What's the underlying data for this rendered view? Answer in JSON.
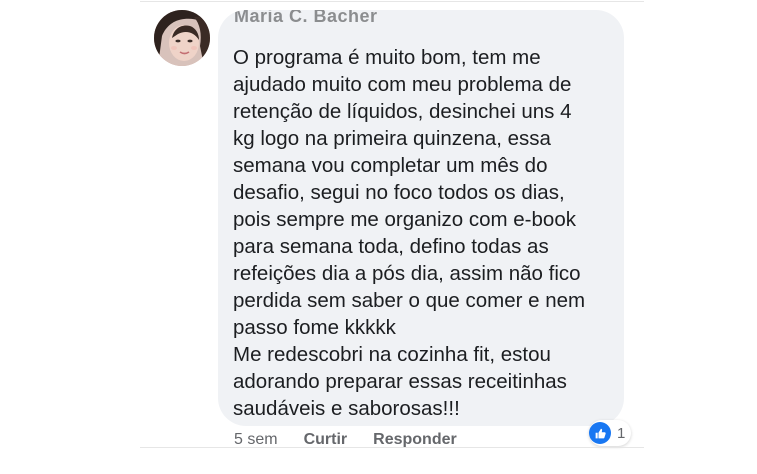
{
  "comment": {
    "author_name": "Maria C. Bacher",
    "text": "O programa é muito bom, tem me\najudado muito com meu problema de\nretenção de líquidos, desinchei uns 4\nkg logo na primeira quinzena, essa\nsemana vou completar um mês do\ndesafio, segui no foco todos os dias,\npois sempre me organizo com e-book\npara semana toda, defino todas as\nrefeições dia a pós dia, assim não fico\nperdida sem saber o que comer e nem\npasso fome kkkkk\nMe redescobri na cozinha fit, estou\nadorando preparar essas receitinhas\nsaudáveis e saborosas!!!",
    "time": "5 sem",
    "actions": {
      "like_label": "Curtir",
      "reply_label": "Responder"
    },
    "reactions": {
      "icon": "like-thumbs-up-icon",
      "count": "1",
      "color": "#1877f2"
    }
  },
  "colors": {
    "bubble": "#f0f2f5",
    "text": "#1c1e21",
    "meta": "#65676b",
    "accent": "#1877f2"
  }
}
